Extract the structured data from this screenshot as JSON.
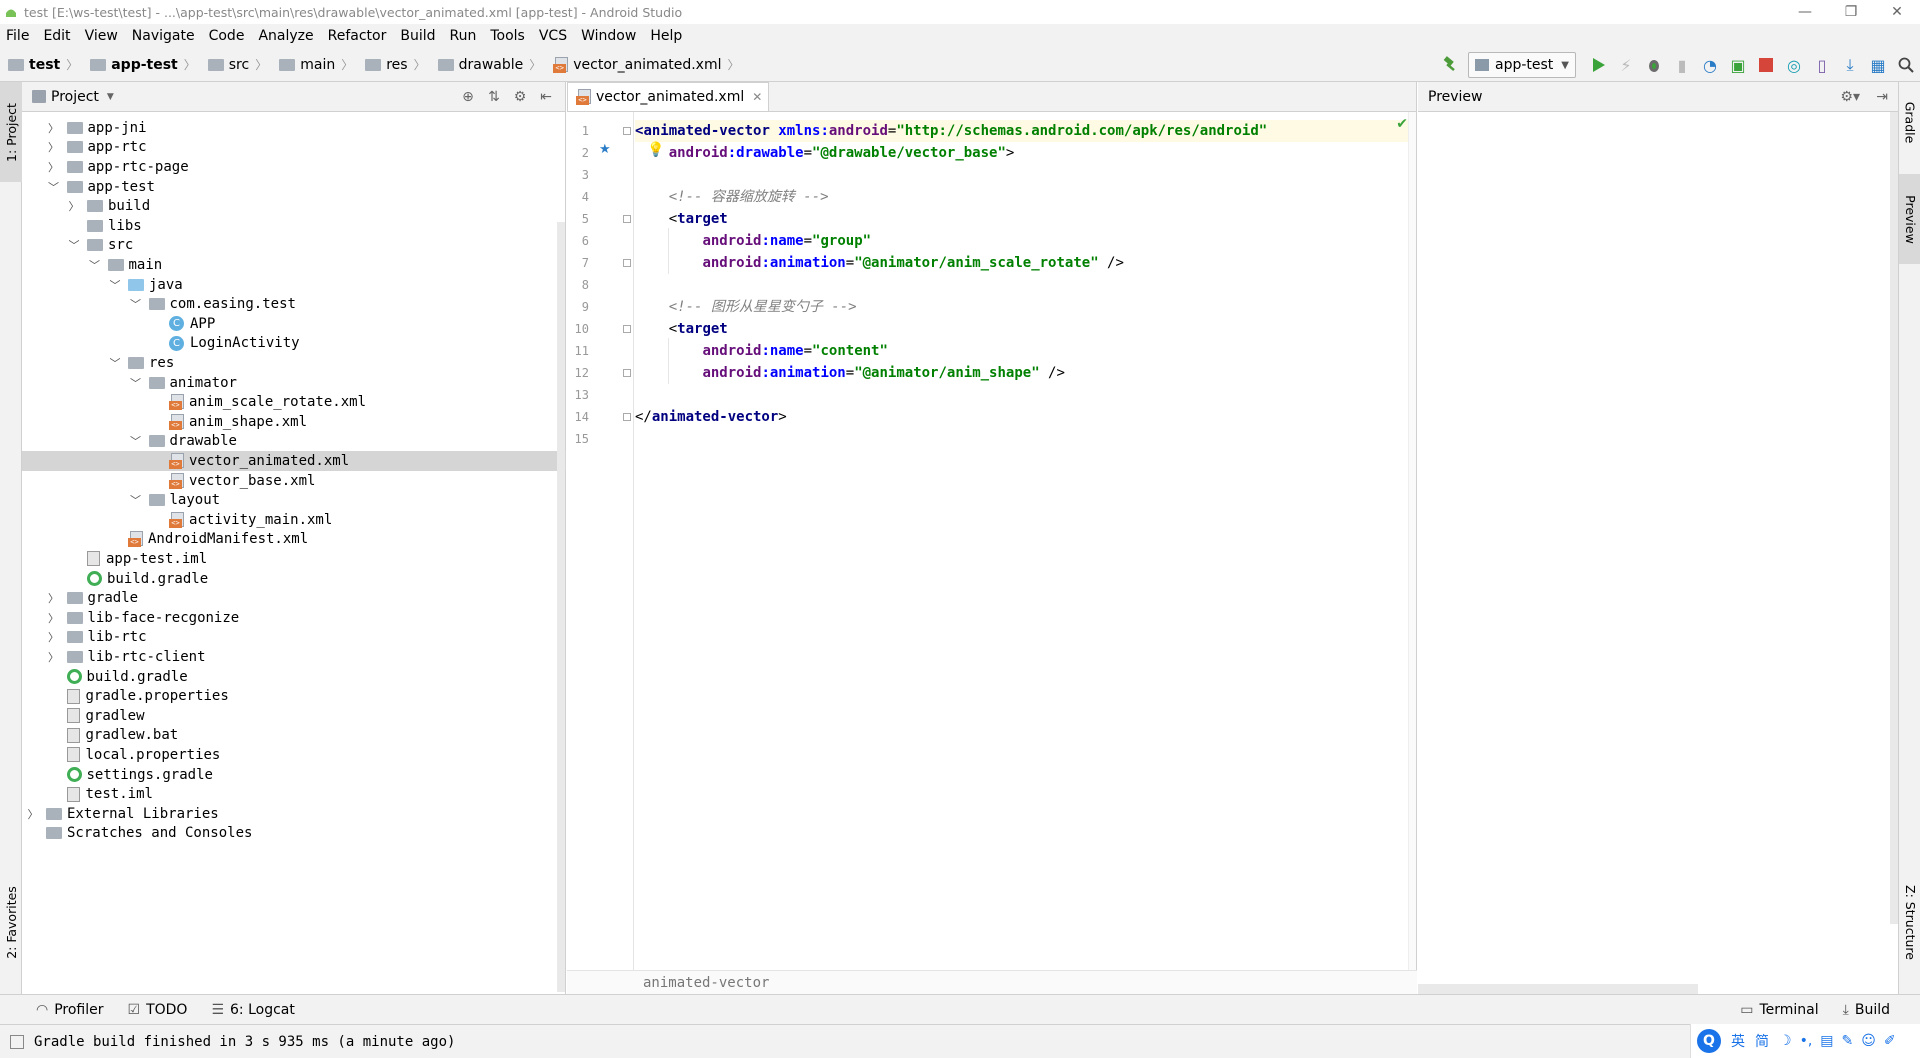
{
  "window": {
    "title": "test [E:\\ws-test\\test] - ...\\app-test\\src\\main\\res\\drawable\\vector_animated.xml [app-test] - Android Studio",
    "minimize": "—",
    "restore": "❐",
    "close": "✕"
  },
  "menu": [
    "File",
    "Edit",
    "View",
    "Navigate",
    "Code",
    "Analyze",
    "Refactor",
    "Build",
    "Run",
    "Tools",
    "VCS",
    "Window",
    "Help"
  ],
  "breadcrumbs": [
    "test",
    "app-test",
    "src",
    "main",
    "res",
    "drawable",
    "vector_animated.xml"
  ],
  "toolbar": {
    "run_config": "app-test"
  },
  "left_tabs": {
    "project": "1: Project",
    "favorites": "2: Favorites"
  },
  "right_tabs": {
    "gradle": "Gradle",
    "preview": "Preview",
    "structure": "Z: Structure"
  },
  "project_panel": {
    "title": "Project",
    "tree": [
      {
        "label": "app-jni",
        "depth": 1,
        "arrow": "right",
        "icon": "folder"
      },
      {
        "label": "app-rtc",
        "depth": 1,
        "arrow": "right",
        "icon": "folder"
      },
      {
        "label": "app-rtc-page",
        "depth": 1,
        "arrow": "right",
        "icon": "folder"
      },
      {
        "label": "app-test",
        "depth": 1,
        "arrow": "down",
        "icon": "folder"
      },
      {
        "label": "build",
        "depth": 2,
        "arrow": "right",
        "icon": "folder"
      },
      {
        "label": "libs",
        "depth": 2,
        "arrow": "none",
        "icon": "folder"
      },
      {
        "label": "src",
        "depth": 2,
        "arrow": "down",
        "icon": "folder"
      },
      {
        "label": "main",
        "depth": 3,
        "arrow": "down",
        "icon": "folder"
      },
      {
        "label": "java",
        "depth": 4,
        "arrow": "down",
        "icon": "folder-blue"
      },
      {
        "label": "com.easing.test",
        "depth": 5,
        "arrow": "down",
        "icon": "package"
      },
      {
        "label": "APP",
        "depth": 6,
        "arrow": "none",
        "icon": "class"
      },
      {
        "label": "LoginActivity",
        "depth": 6,
        "arrow": "none",
        "icon": "class"
      },
      {
        "label": "res",
        "depth": 4,
        "arrow": "down",
        "icon": "folder"
      },
      {
        "label": "animator",
        "depth": 5,
        "arrow": "down",
        "icon": "folder"
      },
      {
        "label": "anim_scale_rotate.xml",
        "depth": 6,
        "arrow": "none",
        "icon": "xml"
      },
      {
        "label": "anim_shape.xml",
        "depth": 6,
        "arrow": "none",
        "icon": "xml"
      },
      {
        "label": "drawable",
        "depth": 5,
        "arrow": "down",
        "icon": "folder"
      },
      {
        "label": "vector_animated.xml",
        "depth": 6,
        "arrow": "none",
        "icon": "xml",
        "selected": true
      },
      {
        "label": "vector_base.xml",
        "depth": 6,
        "arrow": "none",
        "icon": "xml"
      },
      {
        "label": "layout",
        "depth": 5,
        "arrow": "down",
        "icon": "folder"
      },
      {
        "label": "activity_main.xml",
        "depth": 6,
        "arrow": "none",
        "icon": "xml"
      },
      {
        "label": "AndroidManifest.xml",
        "depth": 4,
        "arrow": "none",
        "icon": "manifest"
      },
      {
        "label": "app-test.iml",
        "depth": 2,
        "arrow": "none",
        "icon": "file"
      },
      {
        "label": "build.gradle",
        "depth": 2,
        "arrow": "none",
        "icon": "gradle"
      },
      {
        "label": "gradle",
        "depth": 1,
        "arrow": "right",
        "icon": "folder"
      },
      {
        "label": "lib-face-recgonize",
        "depth": 1,
        "arrow": "right",
        "icon": "folder"
      },
      {
        "label": "lib-rtc",
        "depth": 1,
        "arrow": "right",
        "icon": "folder"
      },
      {
        "label": "lib-rtc-client",
        "depth": 1,
        "arrow": "right",
        "icon": "folder"
      },
      {
        "label": "build.gradle",
        "depth": 1,
        "arrow": "none",
        "icon": "gradle"
      },
      {
        "label": "gradle.properties",
        "depth": 1,
        "arrow": "none",
        "icon": "file"
      },
      {
        "label": "gradlew",
        "depth": 1,
        "arrow": "none",
        "icon": "file"
      },
      {
        "label": "gradlew.bat",
        "depth": 1,
        "arrow": "none",
        "icon": "file"
      },
      {
        "label": "local.properties",
        "depth": 1,
        "arrow": "none",
        "icon": "file"
      },
      {
        "label": "settings.gradle",
        "depth": 1,
        "arrow": "none",
        "icon": "gradle"
      },
      {
        "label": "test.iml",
        "depth": 1,
        "arrow": "none",
        "icon": "file"
      },
      {
        "label": "External Libraries",
        "depth": 0,
        "arrow": "right",
        "icon": "libraries"
      },
      {
        "label": "Scratches and Consoles",
        "depth": 0,
        "arrow": "none",
        "icon": "scratches"
      }
    ]
  },
  "editor": {
    "tab_label": "vector_animated.xml",
    "footer_breadcrumb": "animated-vector",
    "line_numbers": [
      "1",
      "2",
      "3",
      "4",
      "5",
      "6",
      "7",
      "8",
      "9",
      "10",
      "11",
      "12",
      "13",
      "14",
      "15"
    ],
    "lines": [
      [
        {
          "t": "<",
          "c": "tg"
        },
        {
          "t": "animated-vector ",
          "c": "tg"
        },
        {
          "t": "xmlns:",
          "c": "at2"
        },
        {
          "t": "android",
          "c": "at"
        },
        {
          "t": "=",
          "c": ""
        },
        {
          "t": "\"http://schemas.android.com/apk/res/android\"",
          "c": "av"
        }
      ],
      [
        {
          "t": "    ",
          "c": ""
        },
        {
          "t": "android",
          "c": "at"
        },
        {
          "t": ":drawable",
          "c": "at2"
        },
        {
          "t": "=",
          "c": ""
        },
        {
          "t": "\"@drawable/vector_base\"",
          "c": "av"
        },
        {
          "t": ">",
          "c": ""
        }
      ],
      [],
      [
        {
          "t": "    ",
          "c": ""
        },
        {
          "t": "<!-- 容器缩放旋转 -->",
          "c": "cm"
        }
      ],
      [
        {
          "t": "    ",
          "c": ""
        },
        {
          "t": "<",
          "c": ""
        },
        {
          "t": "target",
          "c": "tg"
        }
      ],
      [
        {
          "t": "        ",
          "c": ""
        },
        {
          "t": "android",
          "c": "at"
        },
        {
          "t": ":name",
          "c": "at2"
        },
        {
          "t": "=",
          "c": ""
        },
        {
          "t": "\"group\"",
          "c": "av"
        }
      ],
      [
        {
          "t": "        ",
          "c": ""
        },
        {
          "t": "android",
          "c": "at"
        },
        {
          "t": ":animation",
          "c": "at2"
        },
        {
          "t": "=",
          "c": ""
        },
        {
          "t": "\"@animator/anim_scale_rotate\"",
          "c": "av"
        },
        {
          "t": " />",
          "c": ""
        }
      ],
      [],
      [
        {
          "t": "    ",
          "c": ""
        },
        {
          "t": "<!-- 图形从星星变勺子 -->",
          "c": "cm"
        }
      ],
      [
        {
          "t": "    ",
          "c": ""
        },
        {
          "t": "<",
          "c": ""
        },
        {
          "t": "target",
          "c": "tg"
        }
      ],
      [
        {
          "t": "        ",
          "c": ""
        },
        {
          "t": "android",
          "c": "at"
        },
        {
          "t": ":name",
          "c": "at2"
        },
        {
          "t": "=",
          "c": ""
        },
        {
          "t": "\"content\"",
          "c": "av"
        }
      ],
      [
        {
          "t": "        ",
          "c": ""
        },
        {
          "t": "android",
          "c": "at"
        },
        {
          "t": ":animation",
          "c": "at2"
        },
        {
          "t": "=",
          "c": ""
        },
        {
          "t": "\"@animator/anim_shape\"",
          "c": "av"
        },
        {
          "t": " />",
          "c": ""
        }
      ],
      [],
      [
        {
          "t": "</",
          "c": ""
        },
        {
          "t": "animated-vector",
          "c": "tg"
        },
        {
          "t": ">",
          "c": ""
        }
      ],
      []
    ]
  },
  "preview_panel": {
    "title": "Preview"
  },
  "bottom_tabs": {
    "profiler": "Profiler",
    "todo": "TODO",
    "logcat": "6: Logcat",
    "terminal": "Terminal",
    "build": "Build"
  },
  "status": {
    "message": "Gradle build finished in 3 s 935 ms (a minute ago)"
  },
  "ime": {
    "lang": "英",
    "mode": "简"
  },
  "colors": {
    "tag": "#000080",
    "attr_ns": "#660e7a",
    "attr": "#0000ff",
    "value": "#008000",
    "comment": "#808080",
    "selection": "#d5d5d5",
    "current_line": "#fffae3"
  }
}
